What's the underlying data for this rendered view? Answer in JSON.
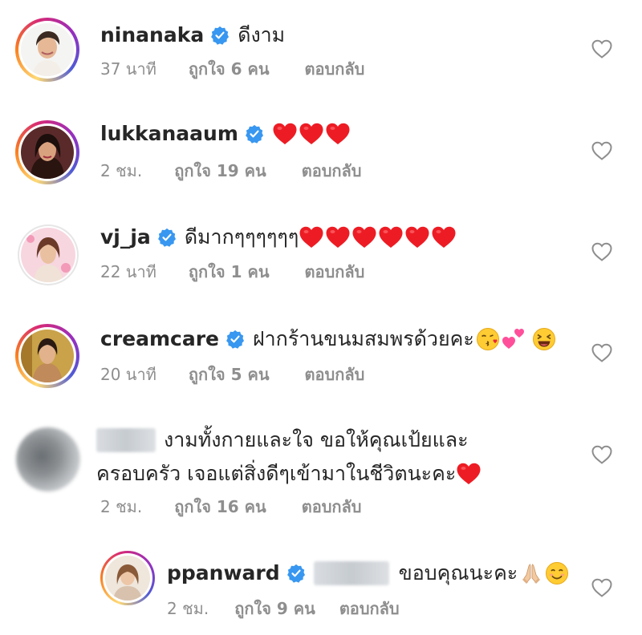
{
  "comments": [
    {
      "username": "ninanaka",
      "verified": true,
      "text": "ดีงาม",
      "time": "37 นาที",
      "likes": "ถูกใจ 6 คน",
      "reply": "ตอบกลับ",
      "avatar": "woman-short-hair-avatar"
    },
    {
      "username": "lukkanaaum",
      "verified": true,
      "text": "",
      "emojis": [
        "red-heart",
        "red-heart",
        "red-heart"
      ],
      "time": "2 ชม.",
      "likes": "ถูกใจ 19 คน",
      "reply": "ตอบกลับ",
      "avatar": "woman-long-dark-hair-avatar"
    },
    {
      "username": "vj_ja",
      "verified": true,
      "text": "ดีมากๆๆๆๆๆๆ",
      "emojis": [
        "red-heart",
        "red-heart",
        "red-heart",
        "red-heart",
        "red-heart",
        "red-heart"
      ],
      "time": "22 นาที",
      "likes": "ถูกใจ 1 คน",
      "reply": "ตอบกลับ",
      "avatar": "woman-pink-background-avatar"
    },
    {
      "username": "creamcare",
      "verified": true,
      "text": "ฝากร้านขนมสมพรด้วยคะ",
      "emojis": [
        "kissing-face",
        "two-hearts",
        "laughing-face"
      ],
      "time": "20 นาที",
      "likes": "ถูกใจ 5 คน",
      "reply": "ตอบกลับ",
      "avatar": "woman-gold-background-avatar"
    },
    {
      "username": "",
      "username_blurred": true,
      "verified": false,
      "text_line1": "งามทั้งกายและใจ ขอให้คุณเป้ยและ",
      "text_line2": "ครอบครัว เจอแต่สิ่งดีๆเข้ามาในชีวิตนะคะ",
      "emojis": [
        "red-heart"
      ],
      "time": "2 ชม.",
      "likes": "ถูกใจ 16 คน",
      "reply": "ตอบกลับ",
      "avatar": "blurred-avatar"
    },
    {
      "username": "ppanward",
      "verified": true,
      "mention_blurred": true,
      "text": "ขอบคุณนะคะ",
      "emojis": [
        "folded-hands",
        "smiling-face"
      ],
      "time": "2 ชม.",
      "likes": "ถูกใจ 9 คน",
      "reply": "ตอบกลับ",
      "avatar": "woman-brown-hair-avatar",
      "is_reply": true
    }
  ],
  "colors": {
    "text": "#262626",
    "secondary": "#8e8e8e",
    "verified_blue": "#3897f0",
    "heart_red": "#ed1c24"
  },
  "icons": {
    "like_button": "heart-outline-icon",
    "verified_badge": "verified-badge-icon"
  }
}
